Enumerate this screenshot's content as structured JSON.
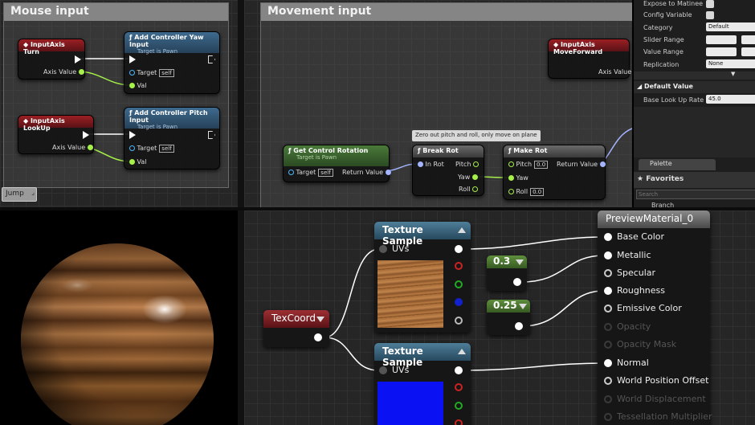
{
  "blueprint": {
    "mouse_input": {
      "title": "Mouse input",
      "turn_event": {
        "title": "InputAxis Turn",
        "axis_value": "Axis Value"
      },
      "yaw_node": {
        "title": "Add Controller Yaw Input",
        "subtitle": "Target is Pawn",
        "target": "Target",
        "target_value": "self",
        "val": "Val"
      },
      "lookup_event": {
        "title": "InputAxis LookUp",
        "axis_value": "Axis Value"
      },
      "pitch_node": {
        "title": "Add Controller Pitch Input",
        "subtitle": "Target is Pawn",
        "target": "Target",
        "target_value": "self",
        "val": "Val"
      },
      "jump_label": "Jump"
    },
    "movement_input": {
      "title": "Movement input",
      "forward_event": {
        "title": "InputAxis MoveForward",
        "axis_value": "Axis Value"
      },
      "comment_bubble": "Zero out pitch and roll, only move on plane",
      "get_control_rotation": {
        "title": "Get Control Rotation",
        "subtitle": "Target is Pawn",
        "target": "Target",
        "target_value": "self",
        "return_value": "Return Value"
      },
      "break_rot": {
        "title": "Break Rot",
        "in_rot": "In Rot",
        "pitch": "Pitch",
        "yaw": "Yaw",
        "roll": "Roll"
      },
      "make_rot": {
        "title": "Make Rot",
        "pitch": "Pitch",
        "pitch_value": "0.0",
        "yaw": "Yaw",
        "roll": "Roll",
        "roll_value": "0.0",
        "return_value": "Return Value"
      }
    }
  },
  "details_panel": {
    "expose_to_matinee": "Expose to Matinee",
    "config_variable": "Config Variable",
    "category": "Category",
    "category_value": "Default",
    "slider_range": "Slider Range",
    "value_range": "Value Range",
    "replication": "Replication",
    "replication_value": "None",
    "default_value_header": "Default Value",
    "base_look_up_rate": "Base Look Up Rate",
    "base_look_up_rate_value": "45.0",
    "palette_tab": "Palette",
    "favorites_header": "Favorites",
    "search_placeholder": "Search",
    "branch_item": "Branch"
  },
  "material_editor": {
    "texcoord": {
      "title": "TexCoord"
    },
    "texture_sample_1": {
      "title": "Texture Sample",
      "uvs": "UVs"
    },
    "texture_sample_2": {
      "title": "Texture Sample",
      "uvs": "UVs"
    },
    "constant_1": {
      "value": "0.3"
    },
    "constant_2": {
      "value": "0.25"
    },
    "preview_material": {
      "title": "PreviewMaterial_0",
      "inputs": {
        "base_color": "Base Color",
        "metallic": "Metallic",
        "specular": "Specular",
        "roughness": "Roughness",
        "emissive_color": "Emissive Color",
        "opacity": "Opacity",
        "opacity_mask": "Opacity Mask",
        "normal": "Normal",
        "world_position_offset": "World Position Offset",
        "world_displacement": "World Displacement",
        "tessellation_multiplier": "Tessellation Multiplier"
      }
    }
  },
  "colors": {
    "event_red": "#9a1f23",
    "function_blue": "#3e6a8e",
    "pure_green": "#4a7a3a",
    "float_pin": "#a6f04a",
    "vector_pin": "#f0c040",
    "rotator_pin": "#a5b4ff",
    "object_pin": "#4cb8ff",
    "wire_white": "#ffffff",
    "normal_map_blue": "#0a12f4"
  }
}
